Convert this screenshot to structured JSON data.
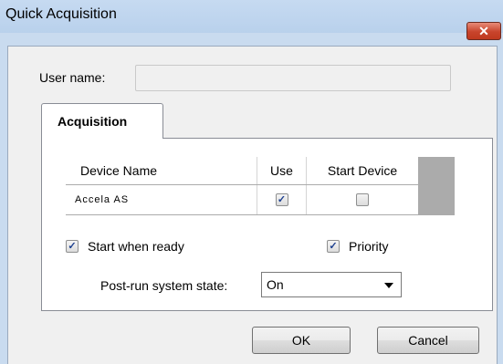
{
  "window": {
    "title": "Quick Acquisition",
    "close_symbol": "✕",
    "close_icon": "close-icon"
  },
  "form": {
    "user_name_label": "User name:",
    "user_name_value": "",
    "user_name_placeholder": ""
  },
  "tabs": [
    {
      "label": "Acquisition",
      "selected": true
    }
  ],
  "devices": {
    "columns": [
      "Device Name",
      "Use",
      "Start Device"
    ],
    "rows": [
      {
        "name": "Accela AS",
        "use": true,
        "start_device": false
      }
    ]
  },
  "options": {
    "start_when_ready": {
      "label": "Start when ready",
      "checked": true
    },
    "priority": {
      "label": "Priority",
      "checked": true
    }
  },
  "post_run": {
    "label": "Post-run system state:",
    "selected": "On"
  },
  "buttons": {
    "ok": "OK",
    "cancel": "Cancel"
  },
  "colors": {
    "frame": "#c9dbef",
    "close_button": "#c8442c",
    "check_mark": "#1c3f8f"
  }
}
